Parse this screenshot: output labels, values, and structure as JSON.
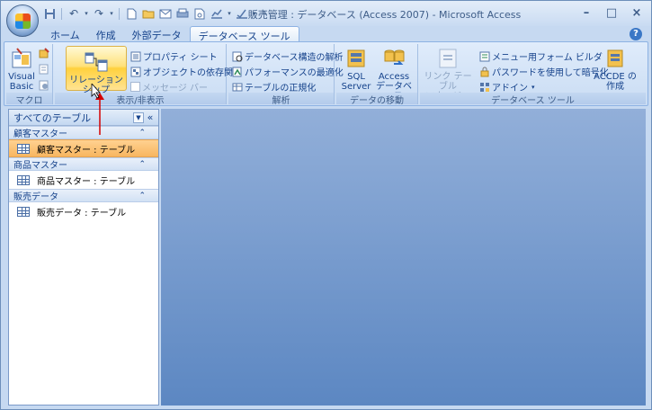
{
  "window": {
    "title": "販売管理 : データベース (Access 2007) - Microsoft Access",
    "controls": {
      "minimize": "–",
      "maximize": "□",
      "close": "×"
    }
  },
  "quick_access": [
    "save-icon",
    "undo-icon",
    "redo-icon",
    "new-icon",
    "open-icon",
    "email-icon",
    "print-icon",
    "preview-icon",
    "chart-icon",
    "dropdown-icon"
  ],
  "tabs": [
    {
      "label": "ホーム",
      "active": false
    },
    {
      "label": "作成",
      "active": false
    },
    {
      "label": "外部データ",
      "active": false
    },
    {
      "label": "データベース ツール",
      "active": true
    }
  ],
  "ribbon": {
    "macro": {
      "title": "マクロ",
      "visual_basic": "Visual\nBasic"
    },
    "show_hide": {
      "title": "表示/非表示",
      "relationships": "リレーションシップ",
      "property_sheet": "プロパティ シート",
      "object_dependencies": "オブジェクトの依存関係",
      "message_bar": "メッセージ バー"
    },
    "analyze": {
      "title": "解析",
      "database_documenter": "データベース構造の解析",
      "performance": "パフォーマンスの最適化",
      "table_analyze": "テーブルの正規化"
    },
    "move_data": {
      "title": "データの移動",
      "sql_server": "SQL\nServer",
      "access_db": "Access\nデータベース"
    },
    "db_tools": {
      "title": "データベース ツール",
      "linked_table_manager": "リンク テーブル\nマネージャ",
      "switchboard": "メニュー用フォーム ビルダ",
      "encrypt": "パスワードを使用して暗号化",
      "addins": "アドイン",
      "make_accde": "ACCDE の\n作成"
    }
  },
  "nav": {
    "header": "すべてのテーブル",
    "groups": [
      {
        "name": "顧客マスター",
        "items": [
          {
            "label": "顧客マスター : テーブル",
            "selected": true
          }
        ]
      },
      {
        "name": "商品マスター",
        "items": [
          {
            "label": "商品マスター : テーブル",
            "selected": false
          }
        ]
      },
      {
        "name": "販売データ",
        "items": [
          {
            "label": "販売データ : テーブル",
            "selected": false
          }
        ]
      }
    ]
  },
  "colors": {
    "accent": "#ffd13d",
    "workspace_top": "#92afd9",
    "workspace_bottom": "#5c87c2",
    "arrow": "#d40000"
  }
}
